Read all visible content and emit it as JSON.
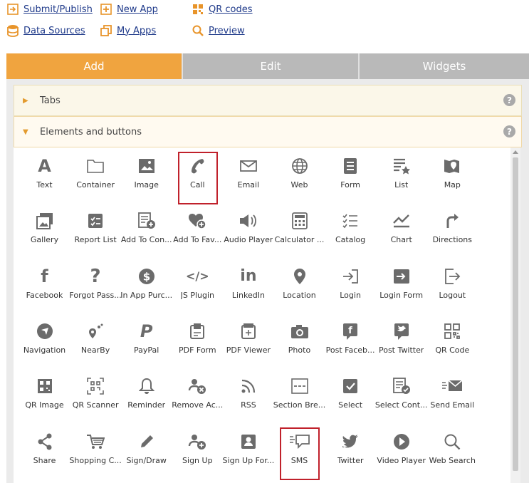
{
  "top_links": [
    {
      "name": "submit-publish-link",
      "icon": "submit-icon",
      "label": "Submit/Publish"
    },
    {
      "name": "new-app-link",
      "icon": "plus-box-icon",
      "label": "New App"
    },
    {
      "name": "qr-codes-link",
      "icon": "qr-code-icon",
      "label": "QR codes"
    },
    {
      "name": "data-sources-link",
      "icon": "database-icon",
      "label": "Data Sources"
    },
    {
      "name": "my-apps-link",
      "icon": "copy-icon",
      "label": "My Apps"
    },
    {
      "name": "preview-link",
      "icon": "search-icon",
      "label": "Preview"
    }
  ],
  "tabs": [
    {
      "name": "tab-add",
      "label": "Add",
      "active": true
    },
    {
      "name": "tab-edit",
      "label": "Edit",
      "active": false
    },
    {
      "name": "tab-widgets",
      "label": "Widgets",
      "active": false
    }
  ],
  "sections": [
    {
      "name": "section-tabs",
      "label": "Tabs",
      "expanded": false,
      "help": "?"
    },
    {
      "name": "section-elements",
      "label": "Elements and buttons",
      "expanded": true,
      "help": "?"
    }
  ],
  "colors": {
    "accent": "#f0a43f",
    "highlight": "#c0212b",
    "link": "#1f3a8a",
    "icon": "#6b6b6b"
  },
  "elements": [
    {
      "label": "Text",
      "icon": "text-icon"
    },
    {
      "label": "Container",
      "icon": "folder-icon"
    },
    {
      "label": "Image",
      "icon": "image-icon"
    },
    {
      "label": "Call",
      "icon": "phone-icon",
      "highlighted": true
    },
    {
      "label": "Email",
      "icon": "envelope-icon"
    },
    {
      "label": "Web",
      "icon": "globe-icon"
    },
    {
      "label": "Form",
      "icon": "form-icon"
    },
    {
      "label": "List",
      "icon": "list-star-icon"
    },
    {
      "label": "Map",
      "icon": "map-icon"
    },
    {
      "label": "Gallery",
      "icon": "gallery-icon"
    },
    {
      "label": "Report List",
      "icon": "report-list-icon"
    },
    {
      "label": "Add To Con...",
      "icon": "add-contact-icon"
    },
    {
      "label": "Add To Fav...",
      "icon": "add-favorite-icon"
    },
    {
      "label": "Audio Player",
      "icon": "speaker-icon"
    },
    {
      "label": "Calculator ...",
      "icon": "calculator-icon"
    },
    {
      "label": "Catalog",
      "icon": "catalog-icon"
    },
    {
      "label": "Chart",
      "icon": "chart-icon"
    },
    {
      "label": "Directions",
      "icon": "directions-icon"
    },
    {
      "label": "Facebook",
      "icon": "facebook-icon"
    },
    {
      "label": "Forgot Pass...",
      "icon": "question-icon"
    },
    {
      "label": "In App Purc...",
      "icon": "dollar-icon"
    },
    {
      "label": "JS Plugin",
      "icon": "code-icon"
    },
    {
      "label": "LinkedIn",
      "icon": "linkedin-icon"
    },
    {
      "label": "Location",
      "icon": "location-pin-icon"
    },
    {
      "label": "Login",
      "icon": "login-icon"
    },
    {
      "label": "Login Form",
      "icon": "login-form-icon"
    },
    {
      "label": "Logout",
      "icon": "logout-icon"
    },
    {
      "label": "Navigation",
      "icon": "navigation-icon"
    },
    {
      "label": "NearBy",
      "icon": "nearby-icon"
    },
    {
      "label": "PayPal",
      "icon": "paypal-icon"
    },
    {
      "label": "PDF Form",
      "icon": "pdf-form-icon"
    },
    {
      "label": "PDF Viewer",
      "icon": "pdf-viewer-icon"
    },
    {
      "label": "Photo",
      "icon": "camera-icon"
    },
    {
      "label": "Post Faceb...",
      "icon": "post-facebook-icon"
    },
    {
      "label": "Post Twitter",
      "icon": "post-twitter-icon"
    },
    {
      "label": "QR Code",
      "icon": "qr-code-icon"
    },
    {
      "label": "QR Image",
      "icon": "qr-image-icon"
    },
    {
      "label": "QR Scanner",
      "icon": "qr-scanner-icon"
    },
    {
      "label": "Reminder",
      "icon": "bell-icon"
    },
    {
      "label": "Remove Ac...",
      "icon": "remove-account-icon"
    },
    {
      "label": "RSS",
      "icon": "rss-icon"
    },
    {
      "label": "Section Bre...",
      "icon": "section-break-icon"
    },
    {
      "label": "Select",
      "icon": "checkbox-icon"
    },
    {
      "label": "Select Cont...",
      "icon": "select-contact-icon"
    },
    {
      "label": "Send Email",
      "icon": "send-email-icon"
    },
    {
      "label": "Share",
      "icon": "share-icon"
    },
    {
      "label": "Shopping C...",
      "icon": "cart-icon"
    },
    {
      "label": "Sign/Draw",
      "icon": "pencil-icon"
    },
    {
      "label": "Sign Up",
      "icon": "sign-up-icon"
    },
    {
      "label": "Sign Up For...",
      "icon": "sign-up-form-icon"
    },
    {
      "label": "SMS",
      "icon": "sms-icon",
      "highlighted": true
    },
    {
      "label": "Twitter",
      "icon": "twitter-icon"
    },
    {
      "label": "Video Player",
      "icon": "play-icon"
    },
    {
      "label": "Web Search",
      "icon": "magnifier-icon"
    }
  ]
}
